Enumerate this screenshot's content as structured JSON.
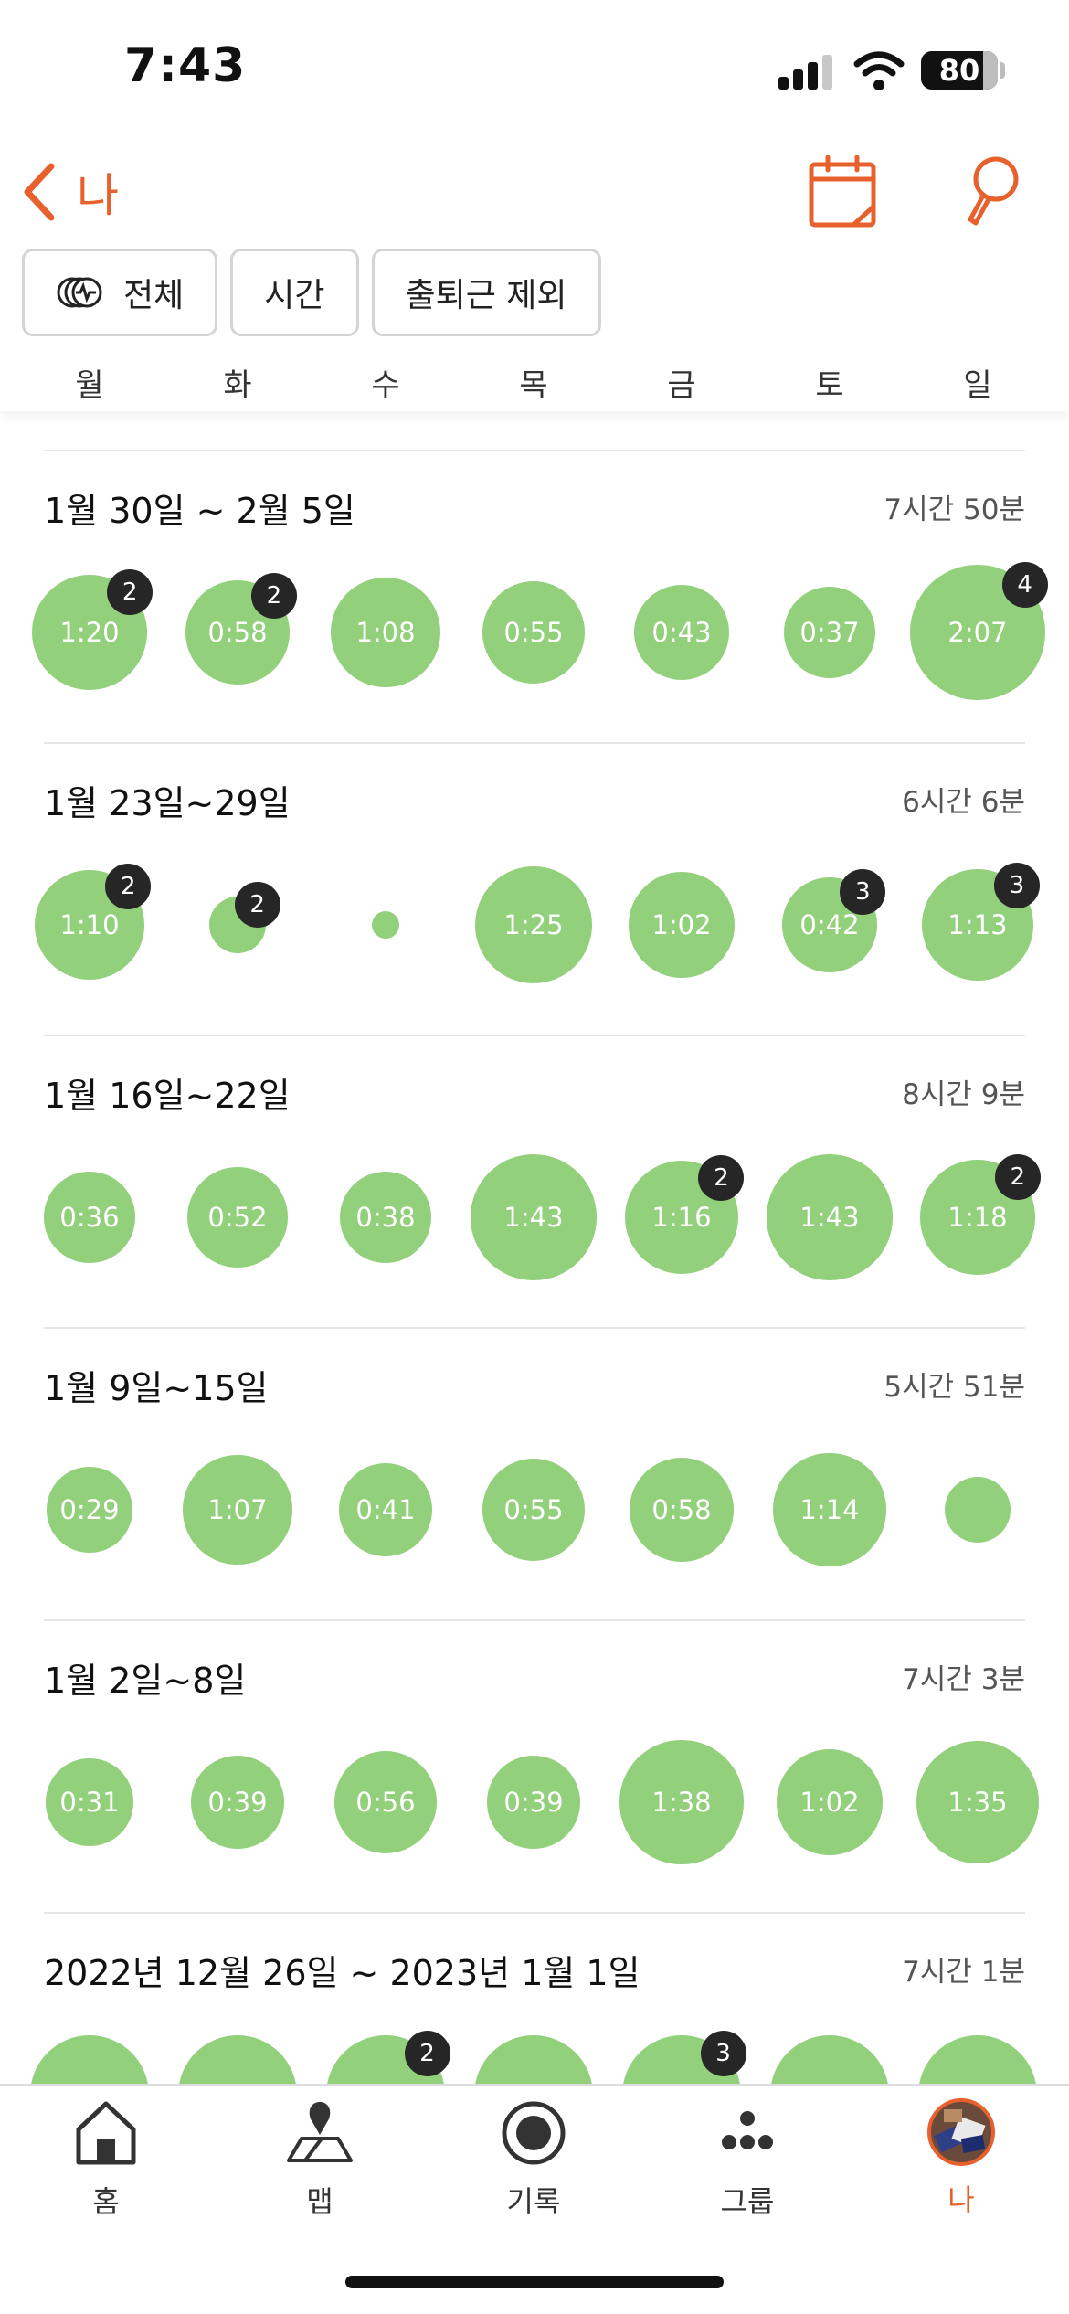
{
  "status_bar": {
    "time": "7:43",
    "battery": "80"
  },
  "nav": {
    "back_label": "나"
  },
  "filters": [
    {
      "label": "전체",
      "icon": "activity-mix-icon"
    },
    {
      "label": "시간"
    },
    {
      "label": "출퇴근 제외"
    }
  ],
  "weekdays": [
    "월",
    "화",
    "수",
    "목",
    "금",
    "토",
    "일"
  ],
  "colors": {
    "accent": "#e8612c",
    "bubble": "#92d07c",
    "badge": "#262626"
  },
  "weeks": [
    {
      "title": "1월 30일 ~ 2월 5일",
      "total": "7시간 50분",
      "days": [
        {
          "label": "1:20",
          "badge": "2"
        },
        {
          "label": "0:58",
          "badge": "2"
        },
        {
          "label": "1:08",
          "badge": ""
        },
        {
          "label": "0:55",
          "badge": ""
        },
        {
          "label": "0:43",
          "badge": ""
        },
        {
          "label": "0:37",
          "badge": ""
        },
        {
          "label": "2:07",
          "badge": "4"
        }
      ]
    },
    {
      "title": "1월 23일~29일",
      "total": "6시간  6분",
      "days": [
        {
          "label": "1:10",
          "badge": "2"
        },
        {
          "label": "",
          "badge": "2"
        },
        {
          "label": "",
          "badge": ""
        },
        {
          "label": "1:25",
          "badge": ""
        },
        {
          "label": "1:02",
          "badge": ""
        },
        {
          "label": "0:42",
          "badge": "3"
        },
        {
          "label": "1:13",
          "badge": "3"
        }
      ]
    },
    {
      "title": "1월 16일~22일",
      "total": "8시간  9분",
      "days": [
        {
          "label": "0:36",
          "badge": ""
        },
        {
          "label": "0:52",
          "badge": ""
        },
        {
          "label": "0:38",
          "badge": ""
        },
        {
          "label": "1:43",
          "badge": ""
        },
        {
          "label": "1:16",
          "badge": "2"
        },
        {
          "label": "1:43",
          "badge": ""
        },
        {
          "label": "1:18",
          "badge": "2"
        }
      ]
    },
    {
      "title": "1월 9일~15일",
      "total": "5시간 51분",
      "days": [
        {
          "label": "0:29",
          "badge": ""
        },
        {
          "label": "1:07",
          "badge": ""
        },
        {
          "label": "0:41",
          "badge": ""
        },
        {
          "label": "0:55",
          "badge": ""
        },
        {
          "label": "0:58",
          "badge": ""
        },
        {
          "label": "1:14",
          "badge": ""
        },
        {
          "label": "",
          "badge": ""
        }
      ]
    },
    {
      "title": "1월 2일~8일",
      "total": "7시간  3분",
      "days": [
        {
          "label": "0:31",
          "badge": ""
        },
        {
          "label": "0:39",
          "badge": ""
        },
        {
          "label": "0:56",
          "badge": ""
        },
        {
          "label": "0:39",
          "badge": ""
        },
        {
          "label": "1:38",
          "badge": ""
        },
        {
          "label": "1:02",
          "badge": ""
        },
        {
          "label": "1:35",
          "badge": ""
        }
      ]
    },
    {
      "title": "2022년 12월 26일 ~ 2023년 1월 1일",
      "total": "7시간  1분",
      "days": [
        {
          "label": "",
          "badge": ""
        },
        {
          "label": "",
          "badge": ""
        },
        {
          "label": "",
          "badge": "2"
        },
        {
          "label": "",
          "badge": ""
        },
        {
          "label": "",
          "badge": "3"
        },
        {
          "label": "",
          "badge": ""
        },
        {
          "label": "",
          "badge": ""
        }
      ]
    }
  ],
  "tabs": [
    {
      "label": "홈",
      "icon": "home-icon"
    },
    {
      "label": "맵",
      "icon": "map-icon"
    },
    {
      "label": "기록",
      "icon": "record-icon"
    },
    {
      "label": "그룹",
      "icon": "group-icon"
    },
    {
      "label": "나",
      "icon": "avatar",
      "active": true
    }
  ]
}
